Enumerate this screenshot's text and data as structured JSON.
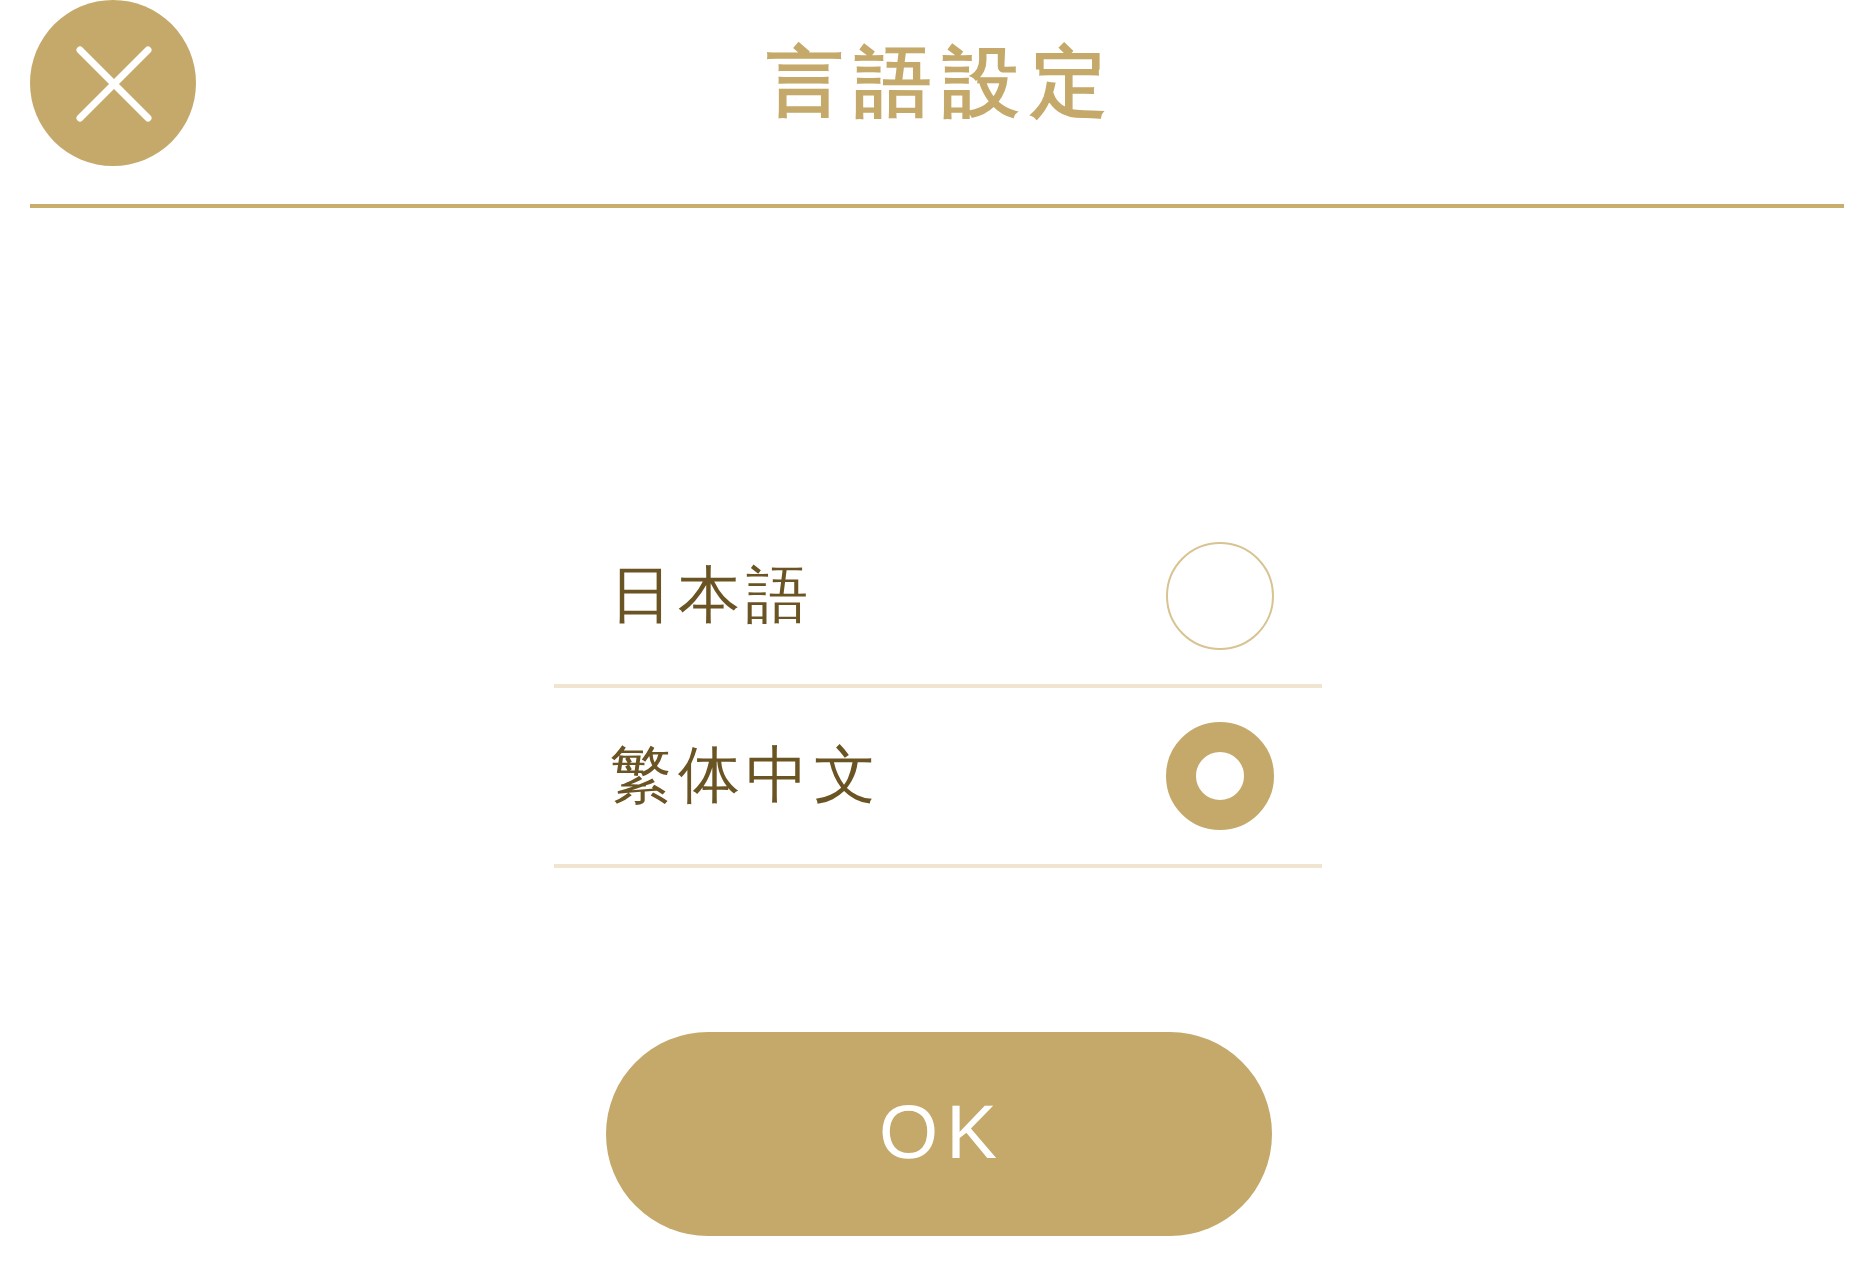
{
  "header": {
    "title": "言語設定"
  },
  "languages": [
    {
      "label": "日本語",
      "selected": false
    },
    {
      "label": "繁体中文",
      "selected": true
    }
  ],
  "buttons": [
    {
      "label": "OK"
    }
  ]
}
